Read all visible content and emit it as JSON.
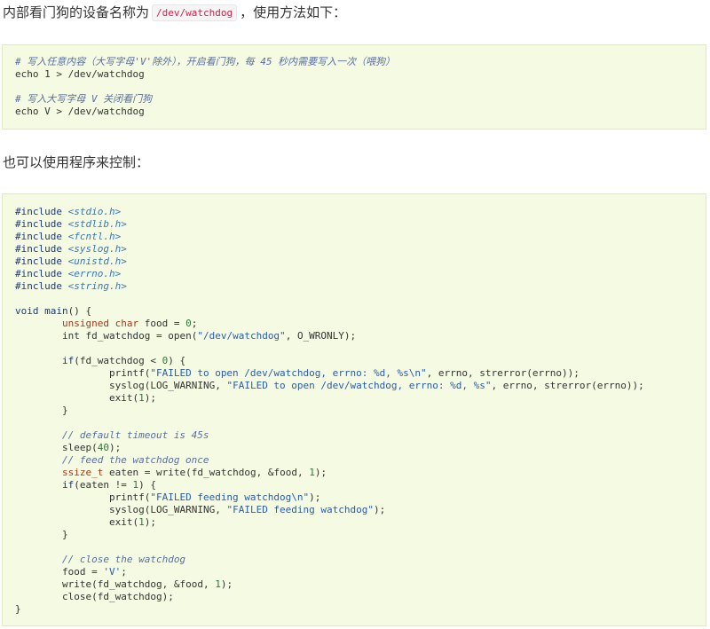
{
  "intro": {
    "before": "内部看门狗的设备名称为",
    "device": "/dev/watchdog",
    "after": "，使用方法如下："
  },
  "shell_block": [
    {
      "type": "comment",
      "text": "# 写入任意内容（大写字母'V'除外），开启看门狗，每 45 秒内需要写入一次（喂狗）"
    },
    {
      "type": "code",
      "text": "echo 1 > /dev/watchdog"
    },
    {
      "type": "blank",
      "text": ""
    },
    {
      "type": "comment",
      "text": "# 写入大写字母 V 关闭看门狗"
    },
    {
      "type": "code",
      "text": "echo V > /dev/watchdog"
    }
  ],
  "second_para": "也可以使用程序来控制：",
  "c_block": {
    "includes": [
      {
        "directive": "#include",
        "header": "<stdio.h>"
      },
      {
        "directive": "#include",
        "header": "<stdlib.h>"
      },
      {
        "directive": "#include",
        "header": "<fcntl.h>"
      },
      {
        "directive": "#include",
        "header": "<syslog.h>"
      },
      {
        "directive": "#include",
        "header": "<unistd.h>"
      },
      {
        "directive": "#include",
        "header": "<errno.h>"
      },
      {
        "directive": "#include",
        "header": "<string.h>"
      }
    ],
    "lines": [
      "",
      "void main() {",
      "        unsigned char food = 0;",
      "        int fd_watchdog = open(\"/dev/watchdog\", O_WRONLY);",
      "",
      "        if(fd_watchdog < 0) {",
      "                printf(\"FAILED to open /dev/watchdog, errno: %d, %s\\n\", errno, strerror(errno));",
      "                syslog(LOG_WARNING, \"FAILED to open /dev/watchdog, errno: %d, %s\", errno, strerror(errno));",
      "                exit(1);",
      "        }",
      "",
      "        // default timeout is 45s",
      "        sleep(40);",
      "        // feed the watchdog once",
      "        ssize_t eaten = write(fd_watchdog, &food, 1);",
      "        if(eaten != 1) {",
      "                printf(\"FAILED feeding watchdog\\n\");",
      "                syslog(LOG_WARNING, \"FAILED feeding watchdog\");",
      "                exit(1);",
      "        }",
      "",
      "        // close the watchdog",
      "        food = 'V';",
      "        write(fd_watchdog, &food, 1);",
      "        close(fd_watchdog);",
      "}"
    ]
  }
}
